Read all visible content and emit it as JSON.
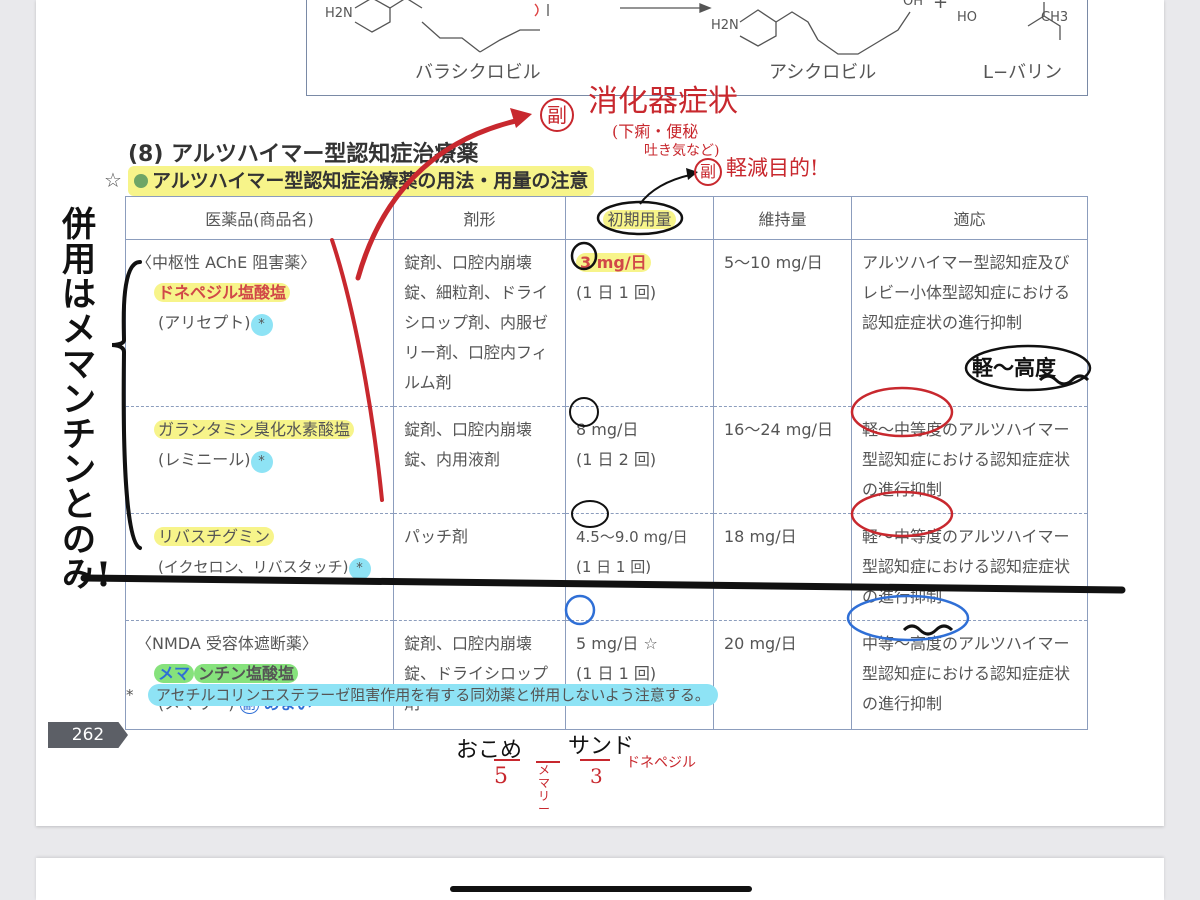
{
  "chem": {
    "valacyclovir": "バラシクロビル",
    "acyclovir": "アシクロビル",
    "valine": "L−バリン",
    "h2n_left": "H2N",
    "h2n_right": "H2N",
    "ho": "HO",
    "oh": "OH",
    "ch3": "CH3",
    "plus": "+"
  },
  "section_title": "(8) アルツハイマー型認知症治療薬",
  "subtitle": "アルツハイマー型認知症治療薬の用法・用量の注意",
  "star": "☆",
  "table": {
    "headers": [
      "医薬品(商品名)",
      "剤形",
      "初期用量",
      "維持量",
      "適応"
    ],
    "group_ache": "〈中枢性 AChE 阻害薬〉",
    "group_nmda": "〈NMDA 受容体遮断薬〉",
    "rows": [
      {
        "drug": "ドネペジル塩酸塩",
        "brand": "(アリセプト)",
        "mark": "*",
        "form": "錠剤、口腔内崩壊錠、細粒剤、ドライシロップ剤、内服ゼリー剤、口腔内フィルム剤",
        "initial": "3 mg/日",
        "initial_freq": "(1 日 1 回)",
        "maint": "5〜10 mg/日",
        "indication": "アルツハイマー型認知症及びレビー小体型認知症における認知症症状の進行抑制"
      },
      {
        "drug": "ガランタミン臭化水素酸塩",
        "brand": "(レミニール)",
        "mark": "*",
        "form": "錠剤、口腔内崩壊錠、内用液剤",
        "initial": "8 mg/日",
        "initial_freq": "(1 日 2 回)",
        "maint": "16〜24 mg/日",
        "indication": "軽〜中等度のアルツハイマー型認知症における認知症症状の進行抑制"
      },
      {
        "drug": "リバスチグミン",
        "brand": "(イクセロン、リバスタッチ)",
        "mark": "*",
        "form": "パッチ剤",
        "initial": "4.5〜9.0 mg/日",
        "initial_freq": "(1 日 1 回)",
        "maint": "18 mg/日",
        "indication": "軽〜中等度のアルツハイマー型認知症における認知症症状の進行抑制"
      },
      {
        "drug_hl": "メマ",
        "drug_rest": "ンチン塩酸塩",
        "brand": "(メマリー)",
        "side": "副",
        "side_text": "めまい",
        "form": "錠剤、口腔内崩壊錠、ドライシロップ剤",
        "initial": "5 mg/日 ☆",
        "initial_freq": "(1 日 1 回)",
        "maint": "20 mg/日",
        "indication": "中等〜高度のアルツハイマー型認知症における認知症症状の進行抑制"
      }
    ]
  },
  "footnote_mark": "*",
  "footnote": "アセチルコリンエステラーゼ阻害作用を有する同効薬と併用しないよう注意する。",
  "page_number": "262",
  "annotations": {
    "side_effect_circle": "副",
    "gi_symptoms": "消化器症状",
    "gi_detail_1": "(下痢・便秘",
    "gi_detail_2": "吐き気など)",
    "side_circle_2": "副",
    "reduce": "軽減目的!",
    "severity": "軽〜高度",
    "vertical_note": "併用はメマンチンとのみ!",
    "mnemonic_1": "おこめ",
    "mnemonic_2": "サンド",
    "mnemonic_num_1": "5",
    "mnemonic_sub_1": "メマリー",
    "mnemonic_num_2": "3",
    "mnemonic_sub_2": "ドネペジル"
  },
  "colors": {
    "highlight_yellow": "#f7f48a",
    "highlight_green": "#86e27c",
    "highlight_cyan": "#8ee3f5",
    "ink_red": "#c8282e",
    "ink_blue": "#2f6fd6",
    "ink_black": "#111111",
    "table_border": "#8c9dbd"
  }
}
